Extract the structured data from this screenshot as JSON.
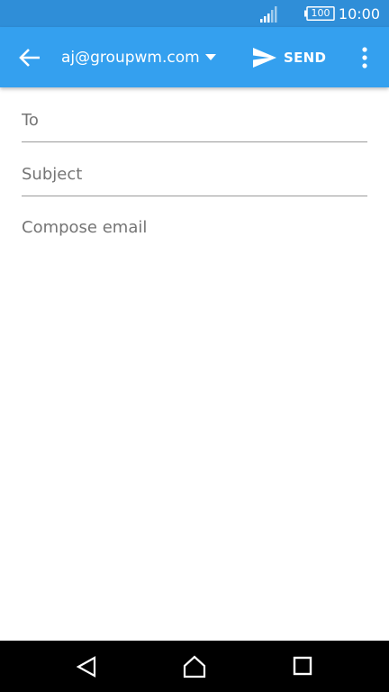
{
  "status_bar": {
    "signal_icon": "cellular-signal-icon",
    "battery_level": "100",
    "time": "10:00"
  },
  "app_bar": {
    "back_icon": "arrow-left-icon",
    "account": "aj@groupwm.com",
    "dropdown_icon": "triangle-down-icon",
    "send_icon": "send-plane-icon",
    "send_label": "SEND",
    "overflow_icon": "more-vertical-icon"
  },
  "compose": {
    "to_placeholder": "To",
    "subject_placeholder": "Subject",
    "body_placeholder": "Compose email"
  },
  "nav_bar": {
    "back_icon": "nav-back-triangle-icon",
    "home_icon": "nav-home-icon",
    "recents_icon": "nav-recents-square-icon"
  },
  "colors": {
    "status_bar": "#2f8ed8",
    "app_bar": "#34a0ef",
    "placeholder_text": "#8a8a8a",
    "divider": "#9a9a9a",
    "nav_bar": "#000000"
  }
}
